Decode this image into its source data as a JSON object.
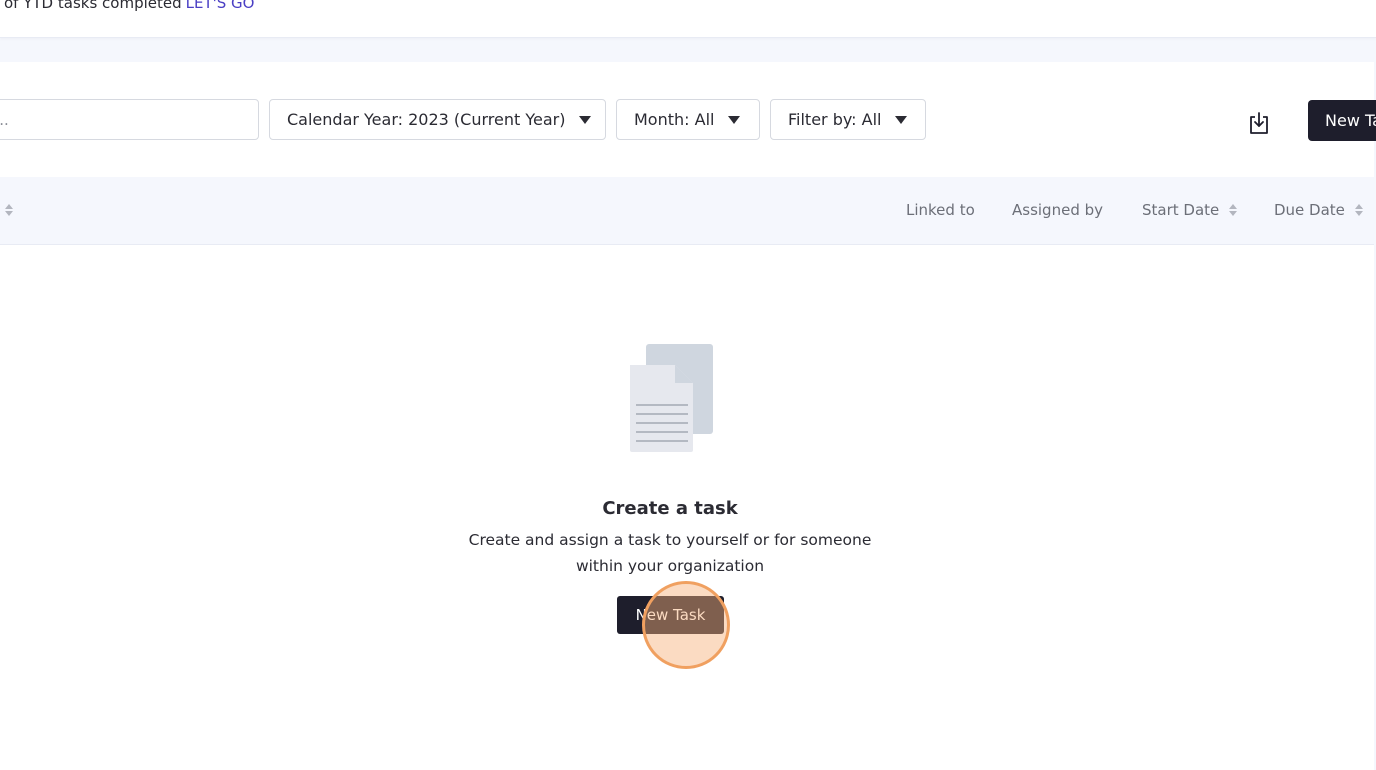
{
  "banner": {
    "text": "of YTD tasks completed",
    "link": "LET'S GO"
  },
  "toolbar": {
    "search_placeholder": "h...",
    "year_filter": "Calendar Year: 2023 (Current Year)",
    "month_filter": "Month: All",
    "type_filter": "Filter by: All",
    "download_icon": "download-icon",
    "new_task_label": "New Task"
  },
  "table": {
    "columns": [
      "Linked to",
      "Assigned by",
      "Start Date",
      "Due Date"
    ]
  },
  "empty_state": {
    "icon": "documents-icon",
    "title": "Create a task",
    "description": "Create and assign a task to yourself or for someone within your organization",
    "button_label": "New Task"
  },
  "colors": {
    "accent_dark": "#1e1e2c",
    "link": "#4a3fc4",
    "click_marker": "#f0a060"
  }
}
